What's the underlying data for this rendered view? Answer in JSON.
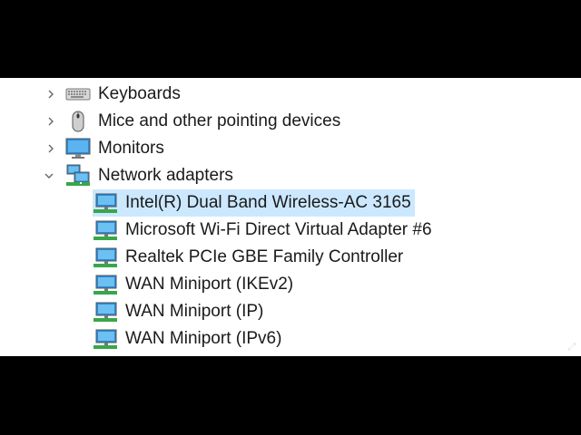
{
  "tree": {
    "categories": [
      {
        "label": "Keyboards",
        "icon": "keyboard-icon",
        "expanded": false
      },
      {
        "label": "Mice and other pointing devices",
        "icon": "mouse-icon",
        "expanded": false
      },
      {
        "label": "Monitors",
        "icon": "monitor-icon",
        "expanded": false
      },
      {
        "label": "Network adapters",
        "icon": "network-adapter-icon",
        "expanded": true
      }
    ],
    "adapters": [
      {
        "label": "Intel(R) Dual Band Wireless-AC 3165",
        "selected": true
      },
      {
        "label": "Microsoft Wi-Fi Direct Virtual Adapter #6"
      },
      {
        "label": "Realtek PCIe GBE Family Controller"
      },
      {
        "label": "WAN Miniport (IKEv2)"
      },
      {
        "label": "WAN Miniport (IP)"
      },
      {
        "label": "WAN Miniport (IPv6)"
      }
    ]
  },
  "colors": {
    "selection": "#cce8ff",
    "monitor_blue": "#2b8ad8",
    "network_green": "#3aa64a"
  }
}
